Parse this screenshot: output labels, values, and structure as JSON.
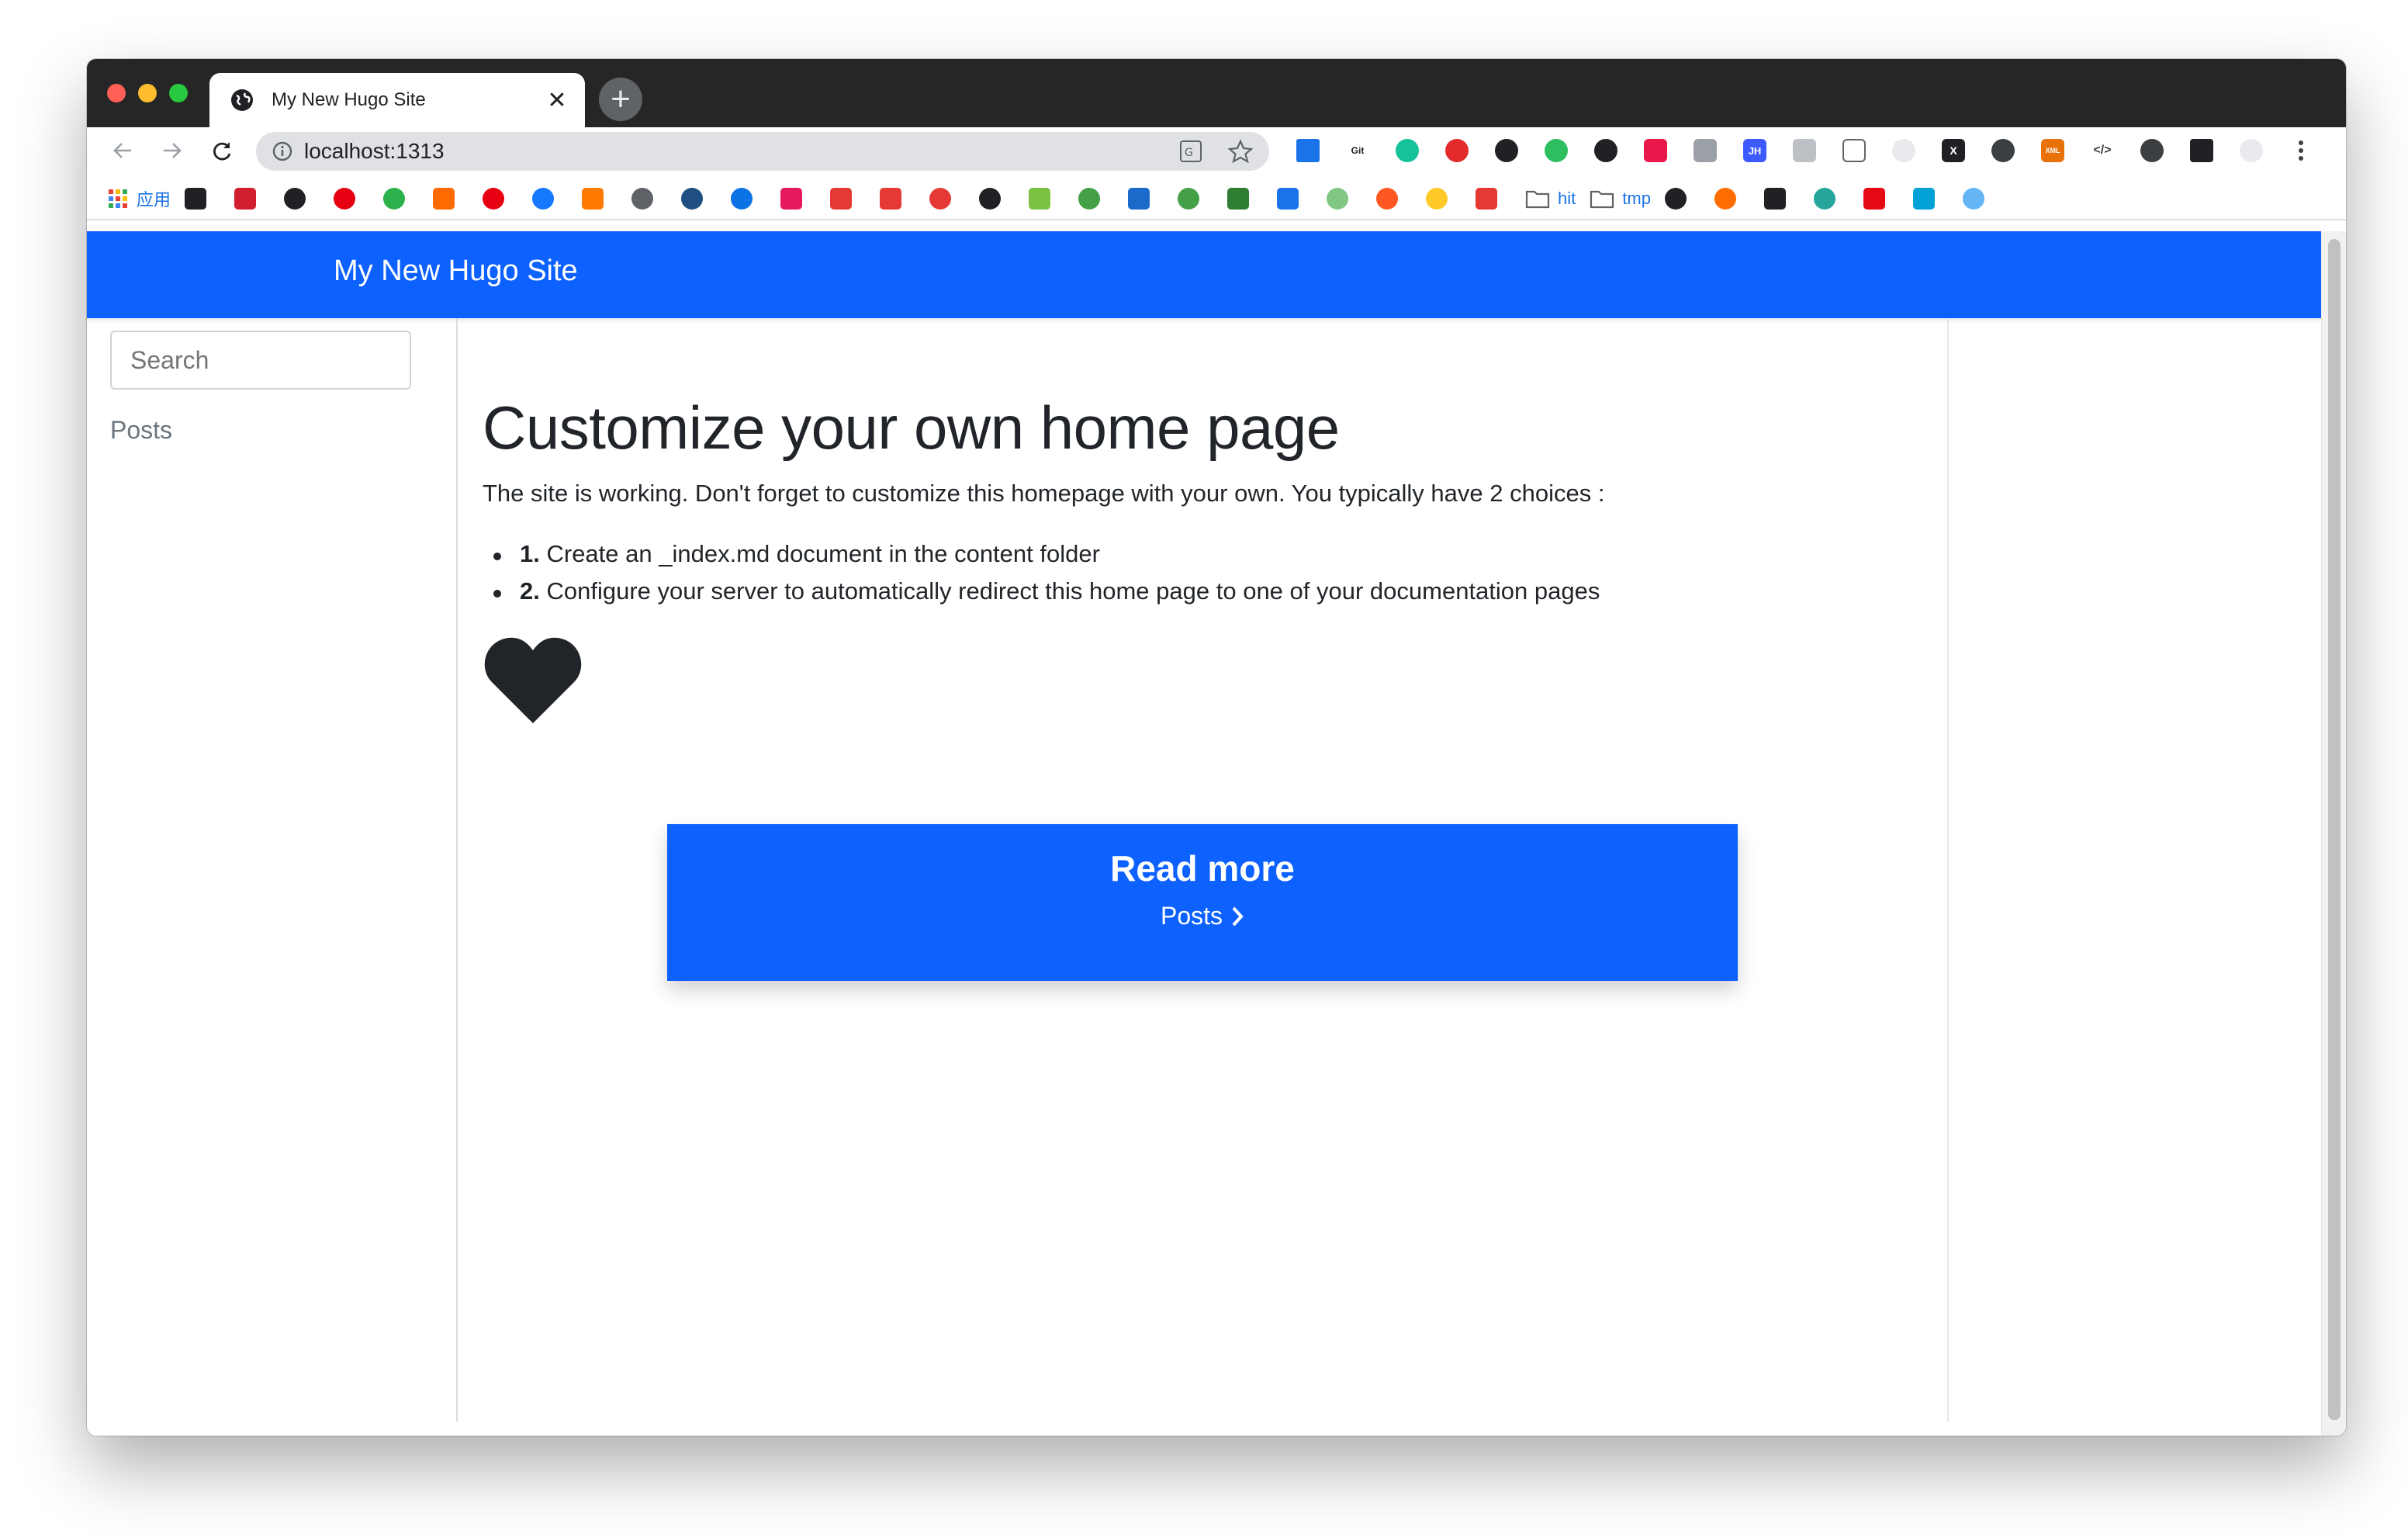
{
  "browser": {
    "tab_title": "My New Hugo Site",
    "tab_close": "✕",
    "new_tab": "+",
    "url": "localhost:1313",
    "bookmarks": {
      "apps_label": "应用",
      "hit_label": "hit",
      "tmp_label": "tmp"
    }
  },
  "site": {
    "title": "My New Hugo Site",
    "search_placeholder": "Search",
    "sidebar_link": "Posts"
  },
  "content": {
    "heading": "Customize your own home page",
    "lead": "The site is working. Don't forget to customize this homepage with your own. You typically have 2 choices :",
    "items": [
      {
        "num": "1.",
        "text": "Create an _index.md document in the content folder"
      },
      {
        "num": "2.",
        "text": "Configure your server to automatically redirect this home page to one of your documentation pages"
      }
    ],
    "cta_title": "Read more",
    "cta_link": "Posts"
  },
  "colors": {
    "brand_blue": "#0d61ff"
  }
}
